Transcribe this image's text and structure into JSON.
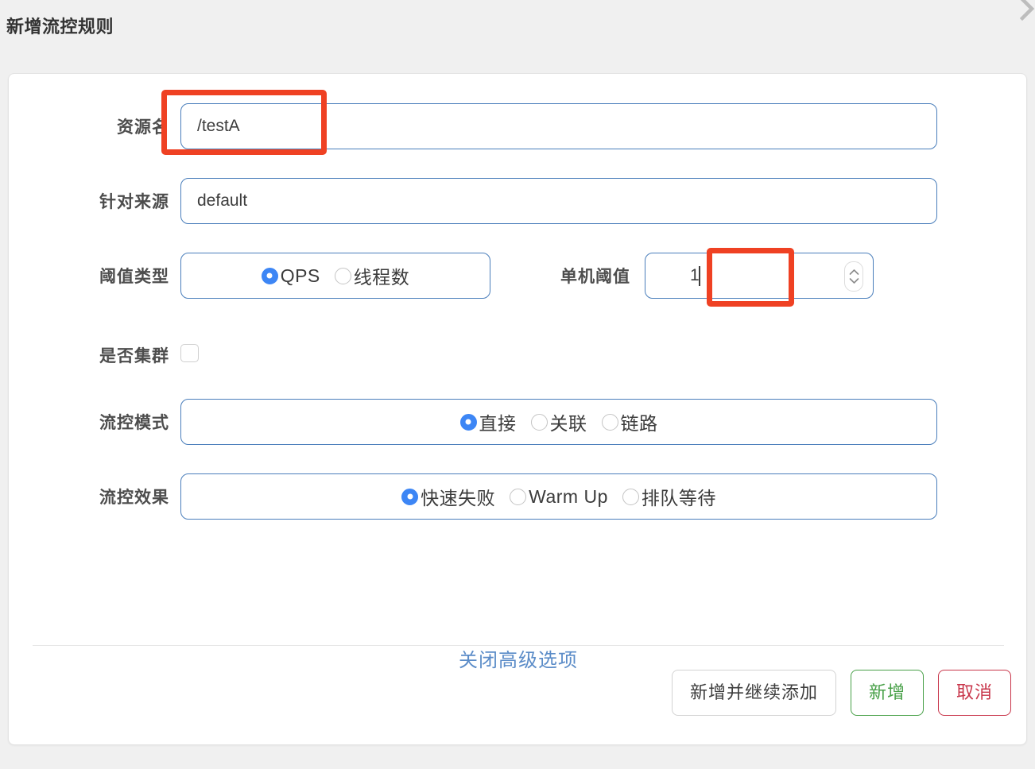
{
  "dialog": {
    "title": "新增流控规则",
    "close_icon": "chevron-right-icon"
  },
  "form": {
    "resource_name": {
      "label": "资源名",
      "value": "/testA",
      "placeholder": "资源名"
    },
    "limit_app": {
      "label": "针对来源",
      "value": "default",
      "placeholder": "default"
    },
    "grade": {
      "label": "阈值类型",
      "options": [
        {
          "label": "QPS",
          "selected": true
        },
        {
          "label": "线程数",
          "selected": false
        }
      ]
    },
    "single_threshold": {
      "label": "单机阈值",
      "value": "1",
      "stepper_up_icon": "chevron-up-icon",
      "stepper_down_icon": "chevron-down-icon"
    },
    "cluster": {
      "label": "是否集群",
      "checked": false,
      "checkbox_icon": "checkbox-unchecked-icon"
    },
    "strategy": {
      "label": "流控模式",
      "options": [
        {
          "label": "直接",
          "selected": true
        },
        {
          "label": "关联",
          "selected": false
        },
        {
          "label": "链路",
          "selected": false
        }
      ]
    },
    "control_behavior": {
      "label": "流控效果",
      "options": [
        {
          "label": "快速失败",
          "selected": true
        },
        {
          "label": "Warm Up",
          "selected": false
        },
        {
          "label": "排队等待",
          "selected": false
        }
      ]
    },
    "advanced_toggle": "关闭高级选项"
  },
  "footer": {
    "add_and_continue": "新增并继续添加",
    "add": "新增",
    "cancel": "取消"
  },
  "annotations": {
    "resource_name_highlight": "resource-name-annotation",
    "threshold_highlight": "threshold-annotation",
    "color": "#ef4123"
  }
}
